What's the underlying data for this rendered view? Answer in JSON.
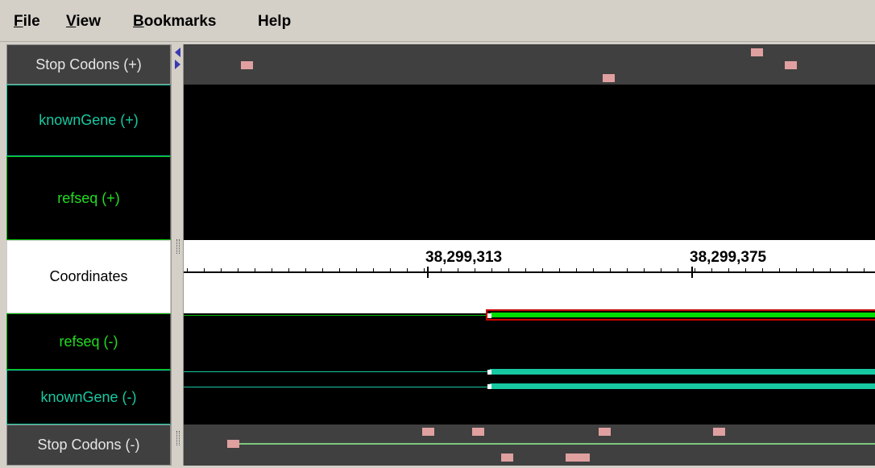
{
  "menu": {
    "items": [
      {
        "mnemonic": "F",
        "rest": "ile"
      },
      {
        "mnemonic": "V",
        "rest": "iew"
      },
      {
        "mnemonic": "B",
        "rest": "ookmarks"
      },
      {
        "mnemonic": "",
        "rest": "Help"
      }
    ]
  },
  "tracks": [
    {
      "id": "stop-plus",
      "label": "Stop Codons (+)"
    },
    {
      "id": "knowngene-plus",
      "label": "knownGene (+)"
    },
    {
      "id": "refseq-plus",
      "label": "refseq (+)"
    },
    {
      "id": "coordinates",
      "label": "Coordinates"
    },
    {
      "id": "refseq-minus",
      "label": "refseq (-)"
    },
    {
      "id": "knowngene-minus",
      "label": "knownGene (-)"
    },
    {
      "id": "stop-minus",
      "label": "Stop Codons (-)"
    }
  ],
  "coordinates": {
    "labels": [
      "38,299,313",
      "38,299,375"
    ]
  },
  "colors": {
    "knownGene": "#16c9a2",
    "refseq": "#00dd00",
    "stopCodon": "#e0a0a0",
    "selection": "#cc0000"
  }
}
